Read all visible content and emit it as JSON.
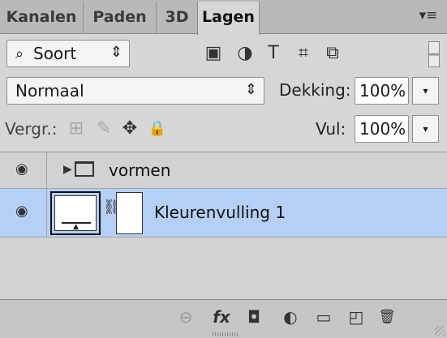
{
  "tabs": [
    {
      "label": "Kanalen"
    },
    {
      "label": "Paden"
    },
    {
      "label": "3D"
    },
    {
      "label": "Lagen",
      "active": true
    }
  ],
  "filter": {
    "kind_label": "Soort",
    "search_icon": "search-icon",
    "arrow_glyph": "⇕",
    "icons": [
      "image-filter-icon",
      "adjustment-filter-icon",
      "type-filter-icon",
      "shape-filter-icon",
      "smart-object-filter-icon"
    ],
    "icon_glyphs": [
      "▣",
      "◑",
      "T",
      "⌗",
      "⧉"
    ]
  },
  "blend": {
    "mode": "Normaal",
    "arrow_glyph": "⇕",
    "opacity_label": "Dekking:",
    "opacity_value": "100%"
  },
  "lock": {
    "label": "Vergr.:",
    "icons": [
      "lock-transparency-icon",
      "lock-paint-icon",
      "lock-position-icon",
      "lock-all-icon"
    ],
    "icon_glyphs": [
      "⊞",
      "✎",
      "✥",
      "🔒"
    ],
    "fill_label": "Vul:",
    "fill_value": "100%"
  },
  "layers": [
    {
      "name": "vormen",
      "type": "group",
      "visible": true,
      "selected": false
    },
    {
      "name": "Kleurenvulling 1",
      "type": "fill",
      "visible": true,
      "selected": true
    }
  ],
  "bottom_toolbar": {
    "icons": [
      "link-layers-icon",
      "fx-icon",
      "layer-mask-icon",
      "adjustment-layer-icon",
      "new-group-icon",
      "new-layer-icon",
      "delete-icon"
    ],
    "glyphs": [
      "⊖",
      "fx",
      "◘",
      "◐",
      "▭",
      "◰",
      "🗑"
    ]
  },
  "colors": {
    "selected_row": "#b5cff5",
    "panel_bg": "#d6d6d6"
  }
}
